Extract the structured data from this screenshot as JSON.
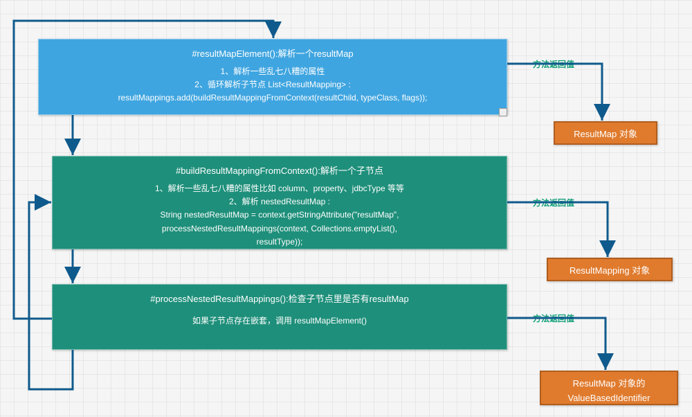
{
  "nodes": {
    "n1": {
      "title": "#resultMapElement():解析一个resultMap",
      "lines": [
        "1、解析一些乱七八糟的属性",
        "2、循环解析子节点 List<ResultMapping> :",
        "resultMappings.add(buildResultMappingFromContext(resultChild, typeClass, flags));"
      ]
    },
    "n2": {
      "title": "#buildResultMappingFromContext():解析一个子节点",
      "lines": [
        "1、解析一些乱七八糟的属性比如 column、property、jdbcType 等等",
        "2、解析 nestedResultMap :",
        "String nestedResultMap = context.getStringAttribute(\"resultMap\",",
        "processNestedResultMappings(context, Collections.emptyList(),",
        "resultType));"
      ]
    },
    "n3": {
      "title": "#processNestedResultMappings():检查子节点里是否有resultMap",
      "lines": [
        "如果子节点存在嵌套，调用 resultMapElement()"
      ]
    }
  },
  "results": {
    "r1": "ResultMap 对象",
    "r2": "ResultMapping 对象",
    "r3a": "ResultMap 对象的",
    "r3b": "ValueBasedIdentifier"
  },
  "labels": {
    "return": "方法返回值"
  }
}
